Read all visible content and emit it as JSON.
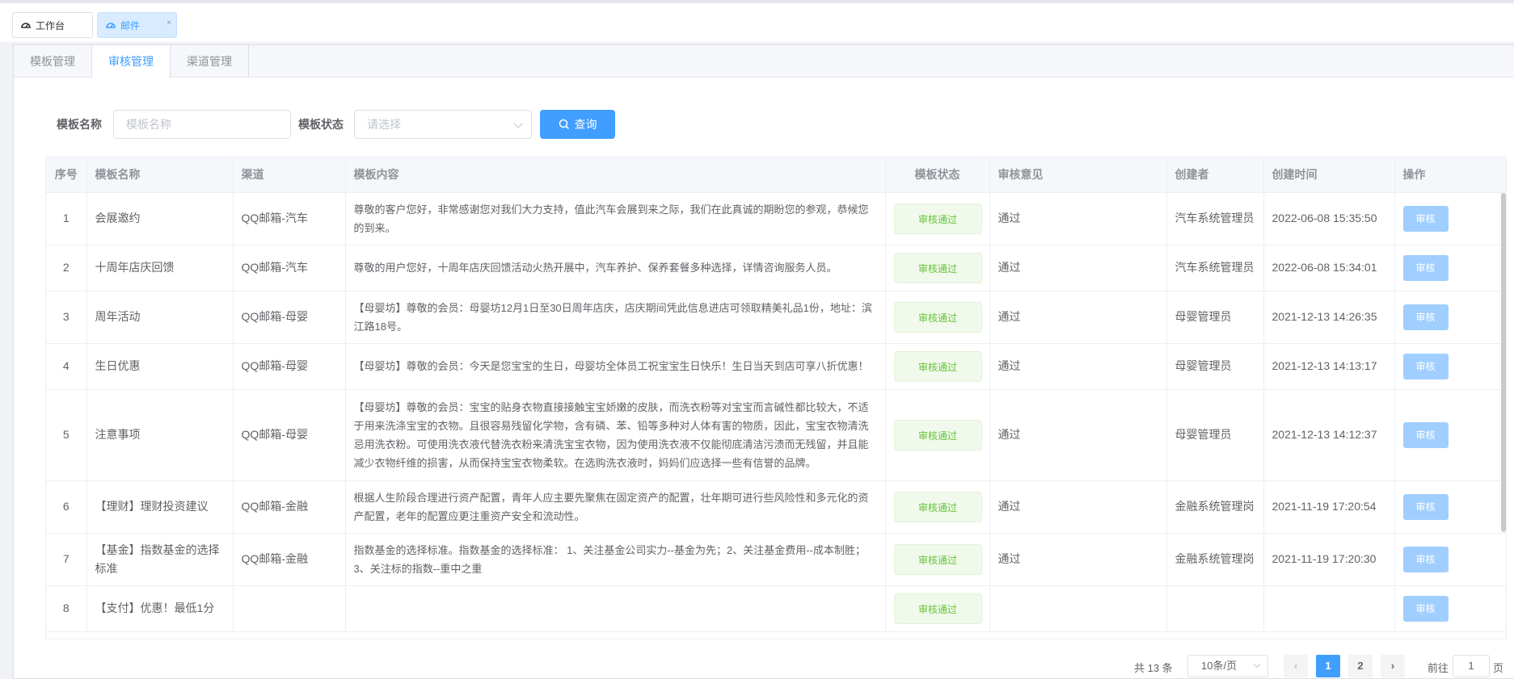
{
  "page_tabs": [
    {
      "label": "工作台",
      "icon": "dashboard-icon"
    },
    {
      "label": "邮件",
      "icon": "dashboard-icon",
      "close": "×"
    }
  ],
  "tabs": [
    "模板管理",
    "审核管理",
    "渠道管理"
  ],
  "active_tab": "审核管理",
  "search": {
    "name_label": "模板名称",
    "name_placeholder": "模板名称",
    "status_label": "模板状态",
    "status_placeholder": "请选择",
    "query_label": "查询"
  },
  "table": {
    "columns": [
      "序号",
      "模板名称",
      "渠道",
      "模板内容",
      "模板状态",
      "审核意见",
      "创建者",
      "创建时间",
      "操作"
    ],
    "rows": [
      {
        "no": "1",
        "name": "会展邀约",
        "channel": "QQ邮箱-汽车",
        "content": "尊敬的客户您好，非常感谢您对我们大力支持，值此汽车会展到来之际，我们在此真诚的期盼您的参观，恭候您的到来。",
        "status": "审核通过",
        "opinion": "通过",
        "creator": "汽车系统管理员",
        "time": "2022-06-08 15:35:50",
        "action": "审核"
      },
      {
        "no": "2",
        "name": "十周年店庆回馈",
        "channel": "QQ邮箱-汽车",
        "content": "尊敬的用户您好，十周年店庆回馈活动火热开展中，汽车养护、保养套餐多种选择，详情咨询服务人员。",
        "status": "审核通过",
        "opinion": "通过",
        "creator": "汽车系统管理员",
        "time": "2022-06-08 15:34:01",
        "action": "审核"
      },
      {
        "no": "3",
        "name": "周年活动",
        "channel": "QQ邮箱-母婴",
        "content": "【母婴坊】尊敬的会员：母婴坊12月1日至30日周年店庆，店庆期间凭此信息进店可领取精美礼品1份，地址：滨江路18号。",
        "status": "审核通过",
        "opinion": "通过",
        "creator": "母婴管理员",
        "time": "2021-12-13 14:26:35",
        "action": "审核"
      },
      {
        "no": "4",
        "name": "生日优惠",
        "channel": "QQ邮箱-母婴",
        "content": "【母婴坊】尊敬的会员：今天是您宝宝的生日，母婴坊全体员工祝宝宝生日快乐！生日当天到店可享八折优惠！",
        "status": "审核通过",
        "opinion": "通过",
        "creator": "母婴管理员",
        "time": "2021-12-13 14:13:17",
        "action": "审核"
      },
      {
        "no": "5",
        "name": "注意事项",
        "channel": "QQ邮箱-母婴",
        "content": "【母婴坊】尊敬的会员：宝宝的贴身衣物直接接触宝宝娇嫩的皮肤，而洗衣粉等对宝宝而言碱性都比较大，不适于用来洗涤宝宝的衣物。且很容易残留化学物，含有磷、苯、铅等多种对人体有害的物质，因此，宝宝衣物清洗忌用洗衣粉。可使用洗衣液代替洗衣粉来清洗宝宝衣物，因为使用洗衣液不仅能彻底清洁污渍而无残留，并且能减少衣物纤维的损害，从而保持宝宝衣物柔软。在选购洗衣液时，妈妈们应选择一些有信誉的品牌。",
        "status": "审核通过",
        "opinion": "通过",
        "creator": "母婴管理员",
        "time": "2021-12-13 14:12:37",
        "action": "审核"
      },
      {
        "no": "6",
        "name": "【理财】理财投资建议",
        "channel": "QQ邮箱-金融",
        "content": "根据人生阶段合理进行资产配置，青年人应主要先聚焦在固定资产的配置，壮年期可进行些风险性和多元化的资产配置，老年的配置应更注重资产安全和流动性。",
        "status": "审核通过",
        "opinion": "通过",
        "creator": "金融系统管理岗",
        "time": "2021-11-19 17:20:54",
        "action": "审核"
      },
      {
        "no": "7",
        "name": "【基金】指数基金的选择标准",
        "channel": "QQ邮箱-金融",
        "content": "指数基金的选择标准。指数基金的选择标准： 1、关注基金公司实力--基金为先；2、关注基金费用--成本制胜；3、关注标的指数--重中之重",
        "status": "审核通过",
        "opinion": "通过",
        "creator": "金融系统管理岗",
        "time": "2021-11-19 17:20:30",
        "action": "审核"
      },
      {
        "no": "8",
        "name": "【支付】优惠！最低1分",
        "channel": "",
        "content": "",
        "status": "审核通过",
        "opinion": "",
        "creator": "",
        "time": "",
        "action": "审核"
      }
    ]
  },
  "pagination": {
    "total": "共 13 条",
    "page_size": "10条/页",
    "pages": [
      "1",
      "2"
    ],
    "current_page": "1",
    "prev": "‹",
    "next": "›",
    "goto_prefix": "前往",
    "goto_value": "1",
    "goto_suffix": "页"
  }
}
